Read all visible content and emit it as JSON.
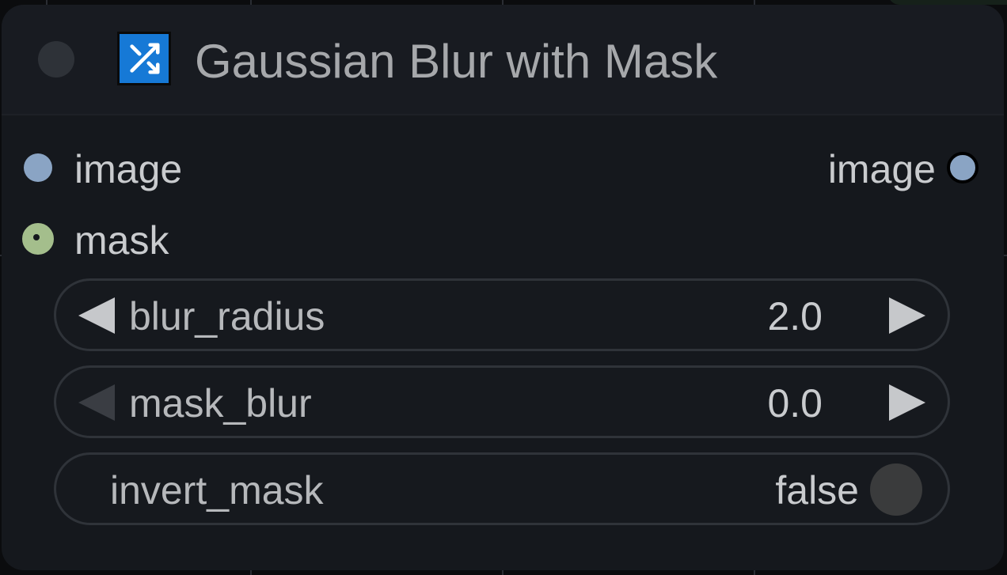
{
  "node": {
    "title": "Gaussian Blur with Mask",
    "icon": "shuffle-icon",
    "accent_color": "#1679d6"
  },
  "inputs": [
    {
      "label": "image",
      "color": "#8aa4c4"
    },
    {
      "label": "mask",
      "color": "#a4be8c"
    }
  ],
  "outputs": [
    {
      "label": "image",
      "color": "#8aa4c4"
    }
  ],
  "widgets": {
    "blur_radius": {
      "label": "blur_radius",
      "value": "2.0"
    },
    "mask_blur": {
      "label": "mask_blur",
      "value": "0.0"
    },
    "invert_mask": {
      "label": "invert_mask",
      "value": "false"
    }
  }
}
